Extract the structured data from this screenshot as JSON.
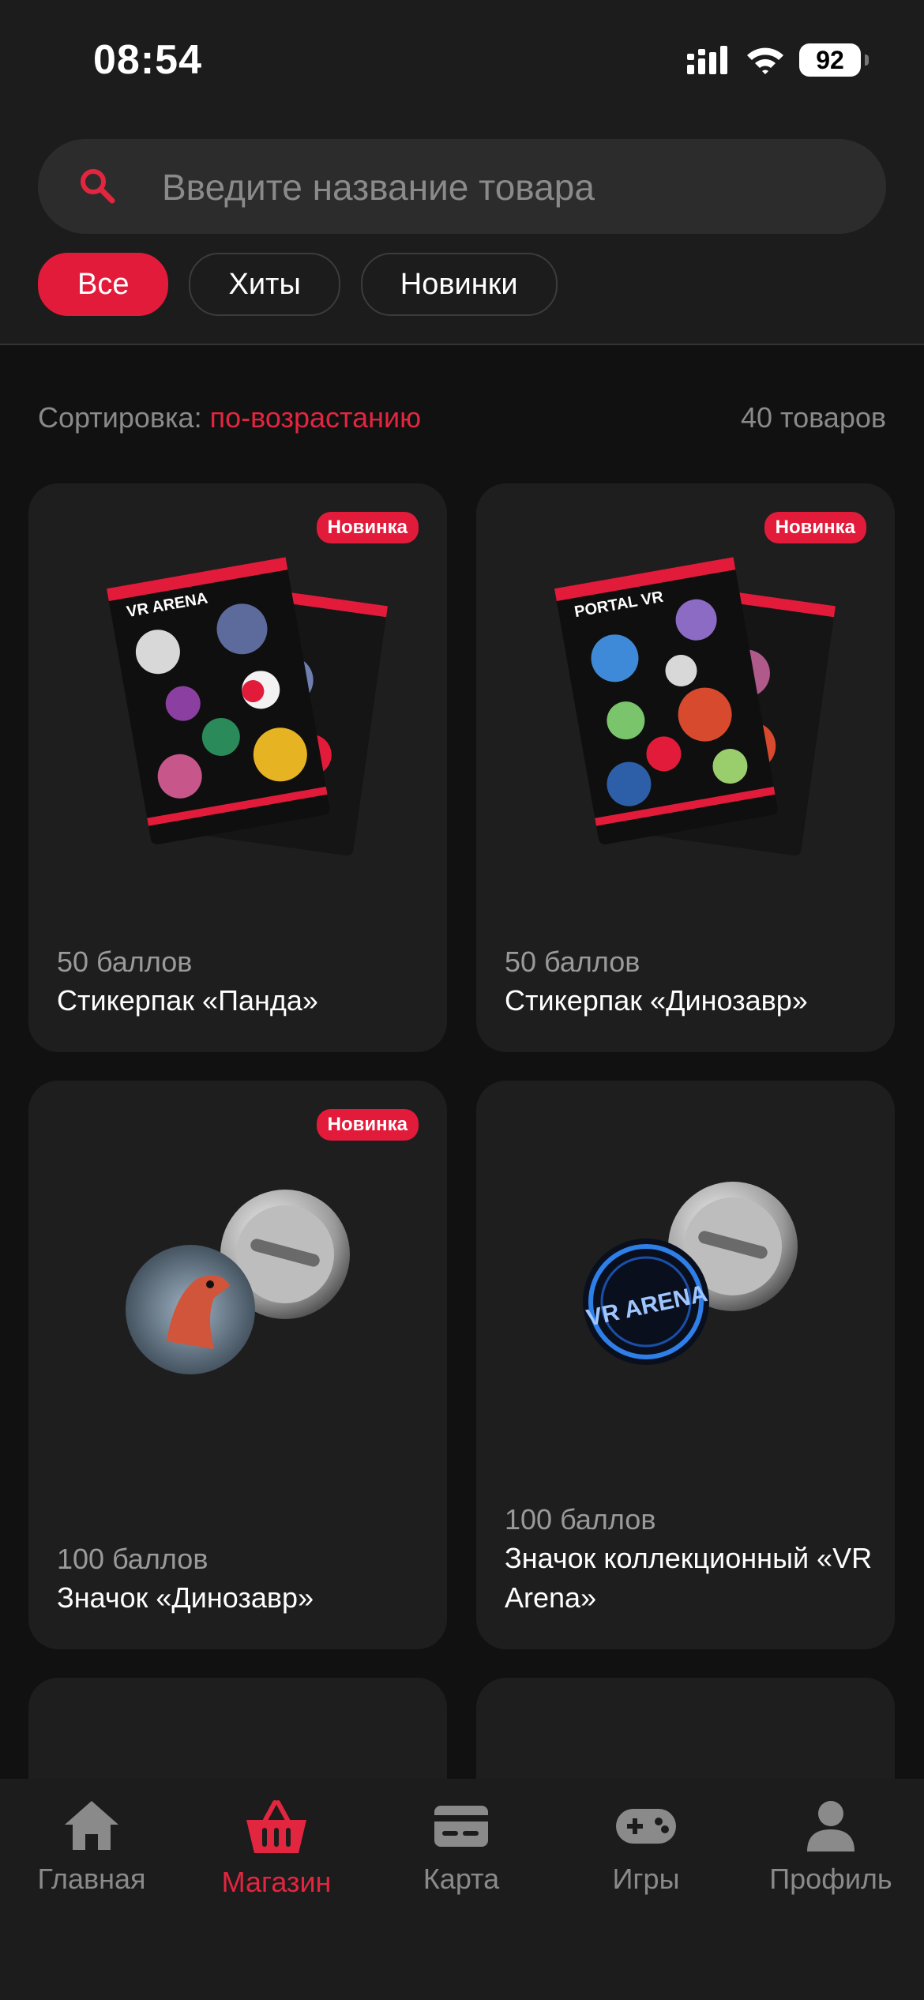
{
  "status": {
    "time": "08:54",
    "battery": "92"
  },
  "search": {
    "placeholder": "Введите название товара"
  },
  "filters": [
    {
      "label": "Все",
      "active": true
    },
    {
      "label": "Хиты",
      "active": false
    },
    {
      "label": "Новинки",
      "active": false
    }
  ],
  "sort": {
    "label": "Сортировка:",
    "value": "по-возрастанию",
    "count": "40 товаров"
  },
  "products": [
    {
      "badge": "Новинка",
      "price": "50 баллов",
      "name": "Стикерпак «Панда»",
      "image": "sticker-pack-vr-arena",
      "sticker_brand": "VR ARENA"
    },
    {
      "badge": "Новинка",
      "price": "50 баллов",
      "name": "Стикерпак «Динозавр»",
      "image": "sticker-pack-portal-vr",
      "sticker_brand": "PORTAL VR"
    },
    {
      "badge": "Новинка",
      "price": "100 баллов",
      "name": " Значок «Динозавр»",
      "image": "pin-badge-dinosaur"
    },
    {
      "badge": "",
      "price": "100 баллов",
      "name": "Значок коллекционный «VR Arena»",
      "image": "pin-badge-vr-arena",
      "pin_text": "VR ARENA"
    }
  ],
  "tabs": [
    {
      "label": "Главная",
      "icon": "home-icon",
      "active": false
    },
    {
      "label": "Магазин",
      "icon": "basket-icon",
      "active": true
    },
    {
      "label": "Карта",
      "icon": "card-icon",
      "active": false
    },
    {
      "label": "Игры",
      "icon": "gamepad-icon",
      "active": false
    },
    {
      "label": "Профиль",
      "icon": "profile-icon",
      "active": false
    }
  ],
  "colors": {
    "accent": "#e31b3b",
    "background": "#111111",
    "surface": "#1e1e1e"
  }
}
